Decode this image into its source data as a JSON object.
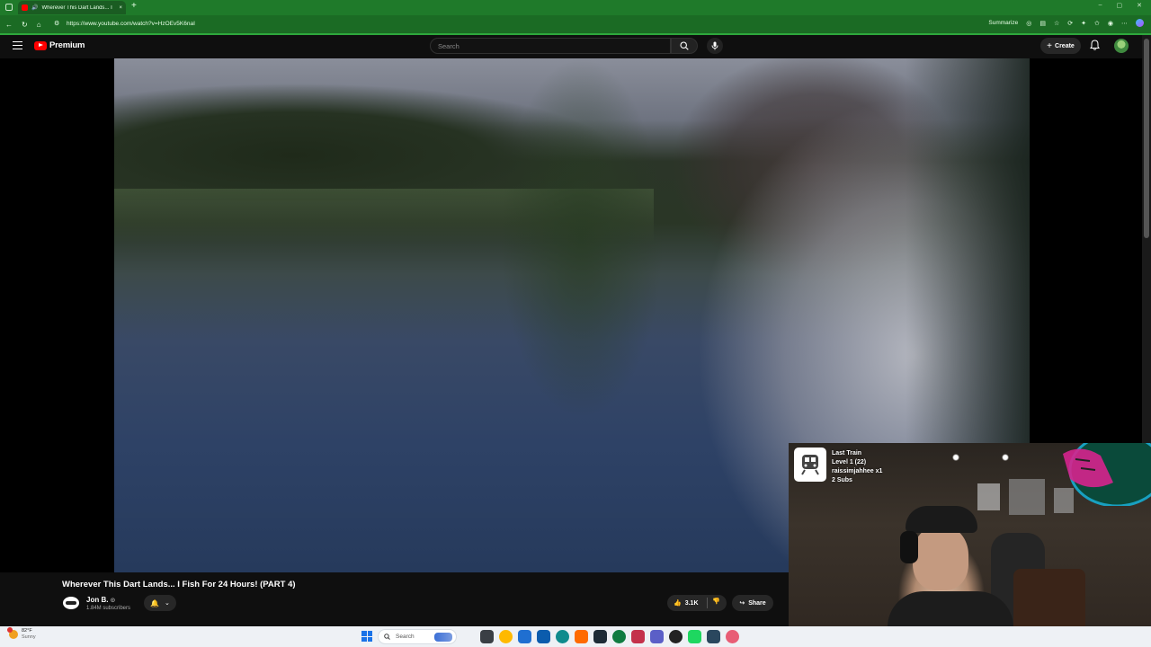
{
  "browser": {
    "tab_title": "Wherever This Dart Lands... I",
    "tab_close": "×",
    "new_tab": "+",
    "url": "https://www.youtube.com/watch?v=HzOEv5K6naI",
    "summarize_label": "Summarize",
    "window_controls": [
      "–",
      "▢",
      "✕"
    ]
  },
  "header": {
    "logo_text": "Premium",
    "search_placeholder": "Search",
    "create_label": "Create"
  },
  "video": {
    "title": "Wherever This Dart Lands... I Fish For 24 Hours! (PART 4)",
    "channel_name": "Jon B.",
    "verified_mark": "⊙",
    "subscribers": "1.84M subscribers",
    "likes": "3.1K",
    "share_label": "Share"
  },
  "webcam_overlay": {
    "line1": "Last Train",
    "line2": "Level 1  (22)",
    "line3": "raissimjahhee x1",
    "line4": "2 Subs"
  },
  "taskbar": {
    "weather_temp": "82°F",
    "weather_condition": "Sunny",
    "search_label": "Search",
    "icon_colors": [
      "#3a3f45",
      "#ffb900",
      "#1f6fd1",
      "#0b5cad",
      "#0f8b8d",
      "#ff6a00",
      "#1d2b36",
      "#107c41",
      "#c4314b",
      "#5b5fc7",
      "#222222",
      "#1ed760",
      "#2a475e",
      "#e85d75"
    ]
  },
  "colors": {
    "browser_green": "#1f7a2a",
    "youtube_red": "#ff0000",
    "dark_bg": "#0f0f0f"
  }
}
